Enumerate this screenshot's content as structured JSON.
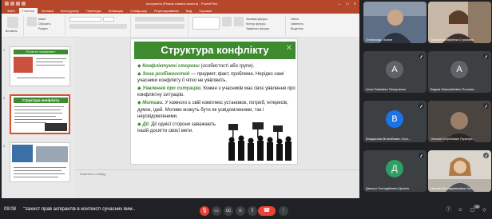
{
  "ppt": {
    "doc_title": "Ассеринна (Режим совместимости) - PowerPoint",
    "tabs": [
      "Файл",
      "Главная",
      "Вставка",
      "Конструктор",
      "Переходы",
      "Анимация",
      "Слайд-шоу",
      "Рецензирование",
      "Вид",
      "Справка"
    ],
    "ribbon_items": [
      "Вставить",
      "Создать слайд",
      "Макет",
      "Сбросить",
      "Раздел",
      "Упорядочить",
      "Экспресс-стили",
      "Заливка фигуры",
      "Контур фигуры",
      "Эффекты фигуры",
      "Найти",
      "Заменить",
      "Выделить"
    ],
    "notes_placeholder": "Заметки к слайду",
    "thumbs": [
      {
        "num": "1",
        "title": "Поняття «конфлікт»"
      },
      {
        "num": "2",
        "title": "Структура конфлікту"
      },
      {
        "num": "3",
        "title": ""
      }
    ]
  },
  "slide": {
    "title": "Структура конфлікту",
    "lines": [
      {
        "bullet": "◆",
        "key": "Конфліктуючі сторони",
        "text": " (особистості або групи)."
      },
      {
        "bullet": "◆",
        "key": "Зона розбіжностей",
        "text": " — предмет, факт, проблема. Нерідко самі учасники конфлікту її чітко не уявляють."
      },
      {
        "bullet": "◆",
        "key": "Уявлення про ситуацію.",
        "text": " Кожен з учасників має своє уявлення про конфліктну ситуацію."
      },
      {
        "bullet": "◆",
        "key": "Мотиви.",
        "text": " У кожного є свій комплекс установок, потреб, інтересів, думок, ідей. Мотиви можуть бути як усвідомленими, так і неусвідомленими."
      },
      {
        "bullet": "◆",
        "key": "Дії.",
        "text": " Дії однієї сторони заважають іншій досягти своєї мети."
      }
    ]
  },
  "participants": [
    {
      "name": "Олександр Ломов",
      "type": "video",
      "color": "#6b7f98"
    },
    {
      "name": "Оксана Валеріївна Страхова",
      "type": "video",
      "color": "#8a7b6f"
    },
    {
      "name": "Алла Павлівна Петрученко",
      "type": "avatar",
      "initial": "A",
      "color": "#5f6368"
    },
    {
      "name": "Вадим Миколайович Понома...",
      "type": "avatar",
      "initial": "A",
      "color": "#5f6368"
    },
    {
      "name": "Владислав Віталійович Серг...",
      "type": "avatar",
      "initial": "В",
      "color": "#1a73e8"
    },
    {
      "name": "Олексій Сергійович Пузатул...",
      "type": "video",
      "color": "#7b6a5c"
    },
    {
      "name": "Дмитро Геннадійович Дьомін",
      "type": "avatar",
      "initial": "Д",
      "color": "#2e9e63"
    },
    {
      "name": "Наталія Володимирівна Зот...",
      "type": "video",
      "color": "#a58a76"
    }
  ],
  "bottombar": {
    "time": "09:08",
    "meeting_title": "\"Захист прав аспірантів в контексті сучасних вим...",
    "controls": [
      "mic-off",
      "camera",
      "captions",
      "emoji",
      "present",
      "raise-hand",
      "more"
    ],
    "end_label": "☎",
    "right_icons": [
      "info",
      "people",
      "chat",
      "activities",
      "lock"
    ],
    "badge": "15"
  }
}
